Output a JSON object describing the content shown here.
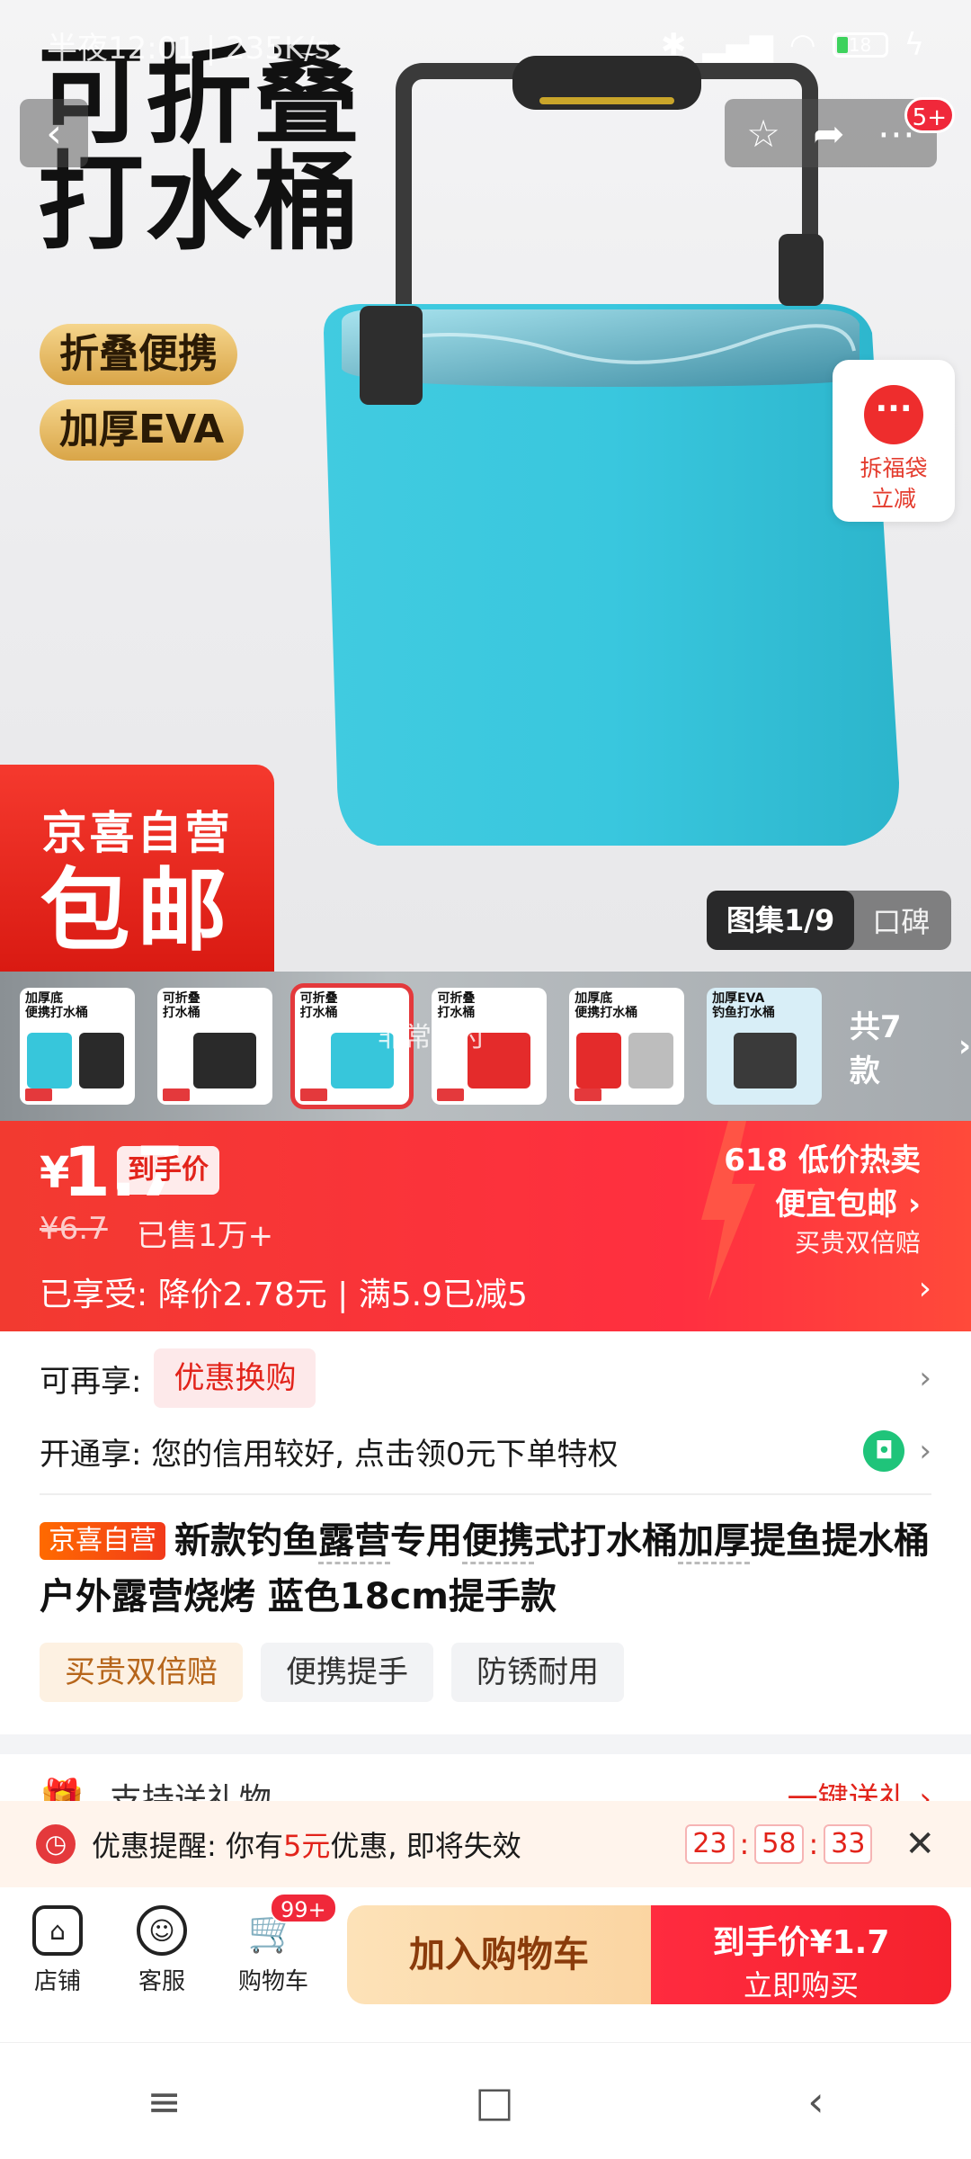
{
  "status": {
    "time_speed": "半夜12:01 | 235K/s",
    "battery": "18"
  },
  "hero": {
    "title_line1": "可折叠",
    "title_line2": "打水桶",
    "feature1": "折叠便携",
    "feature2": "加厚EVA",
    "jd_line1": "京喜自营",
    "jd_line2": "包邮",
    "gallery_active": "图集1/9",
    "gallery_other": "口碑",
    "float_label_line1": "拆福袋",
    "float_label_line2": "立减",
    "badge": "5+"
  },
  "thumbs": {
    "items": [
      {
        "t1": "加厚底",
        "t2": "便携打水桶",
        "color": "#37c6db"
      },
      {
        "t1": "可折叠",
        "t2": "打水桶",
        "color": "#2a2a2a"
      },
      {
        "t1": "可折叠",
        "t2": "打水桶",
        "color": "#37c6db"
      },
      {
        "t1": "可折叠",
        "t2": "打水桶",
        "color": "#e42b2b"
      },
      {
        "t1": "加厚底",
        "t2": "便携打水桶",
        "color": "#e42b2b"
      },
      {
        "t1": "加厚EVA",
        "t2": "钓鱼打水桶",
        "color": "#3aa8e0"
      }
    ],
    "more": "共7款",
    "overlay": "非常专付"
  },
  "price": {
    "yen": "¥",
    "amount": "1.7",
    "tag": "到手价",
    "original": "¥6.7",
    "sold": "已售1万+",
    "enjoy": "已享受: 降价2.78元 | 满5.9已减5",
    "promo1": "618 低价热卖",
    "promo2": "便宜包邮 ›",
    "promo3": "买贵双倍赔"
  },
  "rows": {
    "coupon_label": "可再享:",
    "coupon_tag": "优惠换购",
    "credit": "开通享: 您的信用较好, 点击领0元下单特权"
  },
  "product": {
    "jd_tag": "京喜自营",
    "t_a": "新款钓鱼",
    "t_b": "露营",
    "t_c": "专用",
    "t_d": "便携",
    "t_e": "式打水桶",
    "t_f": "加厚",
    "t_g": "提鱼提水桶户外露营烧烤 蓝色18cm提手款",
    "chips": [
      "买贵双倍赔",
      "便携提手",
      "防锈耐用"
    ]
  },
  "gift": {
    "label": "支持送礼物",
    "action": "一键送礼 ›"
  },
  "remind": {
    "prefix": "优惠提醒: 你有",
    "amount": "5元",
    "suffix": "优惠, 即将失效",
    "h": "23",
    "m": "58",
    "s": "33"
  },
  "bottom": {
    "shop": "店铺",
    "service": "客服",
    "cart": "购物车",
    "cart_badge": "99+",
    "add_cart": "加入购物车",
    "buy_line1": "到手价¥1.7",
    "buy_line2": "立即购买"
  }
}
